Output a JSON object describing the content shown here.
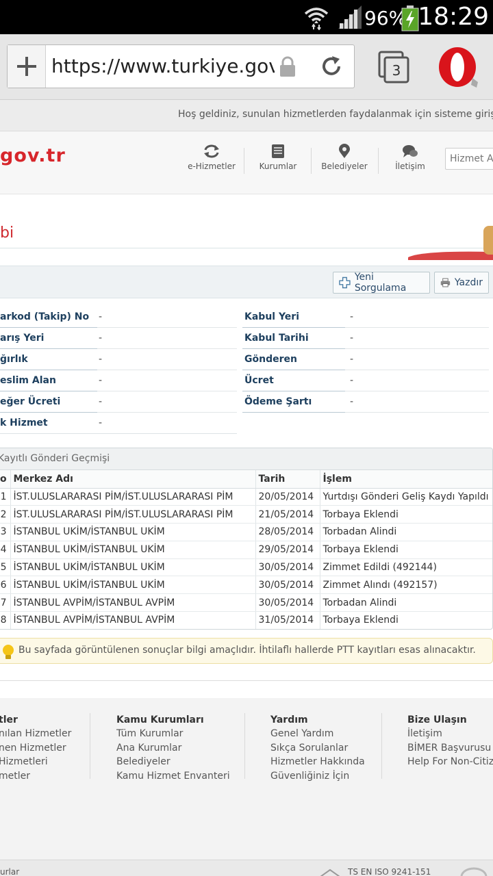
{
  "status_bar": {
    "battery": "96%",
    "time": "18:29"
  },
  "browser": {
    "url": "https://www.turkiye.gov.tr",
    "tab_count": "3"
  },
  "welcome_text": "Hoş geldiniz, sunulan hizmetlerden faydalanmak için sisteme giriş yapmalısınız",
  "header": {
    "logo": "gov.tr",
    "nav": [
      "e-Hizmetler",
      "Kurumlar",
      "Belediyeler",
      "İletişim"
    ],
    "search_placeholder": "Hizmet Adı"
  },
  "page_title": "bi",
  "toolbar": {
    "new_query": "Yeni Sorgulama",
    "print": "Yazdır"
  },
  "info_left": [
    {
      "label": "arkod (Takip) No",
      "value": "-"
    },
    {
      "label": "arış Yeri",
      "value": "-"
    },
    {
      "label": "ğırlık",
      "value": "-"
    },
    {
      "label": "eslim Alan",
      "value": "-"
    },
    {
      "label": "eğer Ücreti",
      "value": "-"
    },
    {
      "label": "k Hizmet",
      "value": "-"
    }
  ],
  "info_right": [
    {
      "label": "Kabul Yeri",
      "value": "-"
    },
    {
      "label": "Kabul Tarihi",
      "value": "-"
    },
    {
      "label": "Gönderen",
      "value": "-"
    },
    {
      "label": "Ücret",
      "value": "-"
    },
    {
      "label": "Ödeme Şartı",
      "value": "-"
    }
  ],
  "history": {
    "title": "Kayıtlı Gönderi Geçmişi",
    "columns": [
      "o",
      "Merkez Adı",
      "Tarih",
      "İşlem"
    ],
    "rows": [
      {
        "no": "1",
        "center": "İST.ULUSLARARASI PİM/İST.ULUSLARARASI PİM",
        "date": "20/05/2014",
        "action": "Yurtdışı Gönderi Geliş Kaydı Yapıldı"
      },
      {
        "no": "2",
        "center": "İST.ULUSLARARASI PİM/İST.ULUSLARARASI PİM",
        "date": "21/05/2014",
        "action": "Torbaya Eklendi"
      },
      {
        "no": "3",
        "center": "İSTANBUL UKİM/İSTANBUL UKİM",
        "date": "28/05/2014",
        "action": "Torbadan Alindi"
      },
      {
        "no": "4",
        "center": "İSTANBUL UKİM/İSTANBUL UKİM",
        "date": "29/05/2014",
        "action": "Torbaya Eklendi"
      },
      {
        "no": "5",
        "center": "İSTANBUL UKİM/İSTANBUL UKİM",
        "date": "30/05/2014",
        "action": "Zimmet Edildi (492144)"
      },
      {
        "no": "6",
        "center": "İSTANBUL UKİM/İSTANBUL UKİM",
        "date": "30/05/2014",
        "action": "Zimmet Alındı (492157)"
      },
      {
        "no": "7",
        "center": "İSTANBUL AVPİM/İSTANBUL AVPİM",
        "date": "30/05/2014",
        "action": "Torbadan Alindi"
      },
      {
        "no": "8",
        "center": "İSTANBUL AVPİM/İSTANBUL AVPİM",
        "date": "31/05/2014",
        "action": "Torbaya Eklendi"
      }
    ]
  },
  "note": "Bu sayfada görüntülenen sonuçlar bilgi amaçlıdır. İhtilaflı hallerde PTT kayıtları esas alınacaktır.",
  "footer": {
    "columns": [
      {
        "title": "tler",
        "links": [
          "nılan Hizmetler",
          "nen Hizmetler",
          "Hizmetleri",
          "metler"
        ]
      },
      {
        "title": "Kamu Kurumları",
        "links": [
          "Tüm Kurumlar",
          "Ana Kurumlar",
          "Belediyeler",
          "Kamu Hizmet Envanteri"
        ]
      },
      {
        "title": "Yardım",
        "links": [
          "Genel Yardım",
          "Sıkça Sorulanlar",
          "Hizmetler Hakkında",
          "Güvenliğiniz İçin"
        ]
      },
      {
        "title": "Bize Ulaşın",
        "links": [
          "İletişim",
          "BİMER Başvurusu",
          "Help For Non-Citizens"
        ]
      }
    ]
  },
  "bottom_bar": {
    "left": "urlar",
    "cert": "TS EN ISO 9241-151"
  }
}
